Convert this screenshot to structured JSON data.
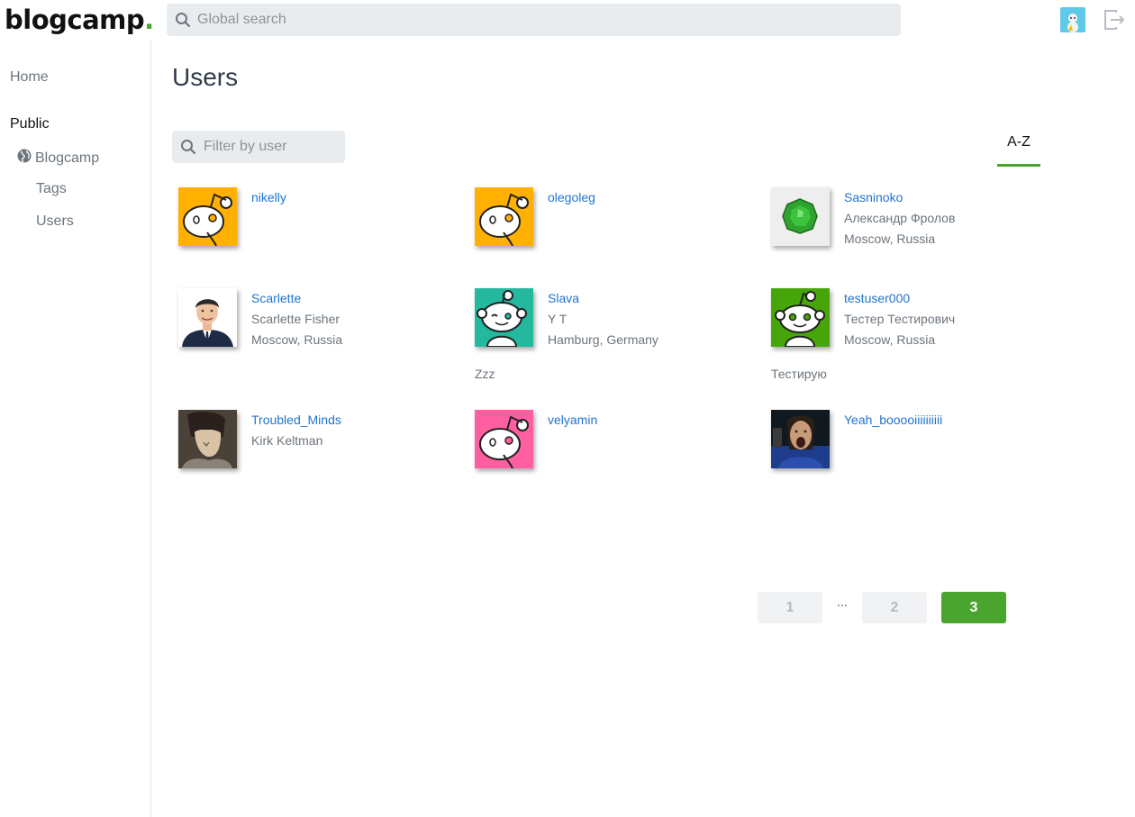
{
  "header": {
    "logo_text": "blogcamp",
    "logo_dot": ".",
    "search_placeholder": "Global search"
  },
  "sidebar": {
    "home": "Home",
    "public": "Public",
    "blogcamp": "Blogcamp",
    "tags": "Tags",
    "users": "Users"
  },
  "main": {
    "title": "Users",
    "filter_placeholder": "Filter by user",
    "sort_tab": "A-Z"
  },
  "users": [
    {
      "username": "nikelly",
      "name": "",
      "location": "",
      "about": "",
      "avatar": "reddit-snoo-thinking",
      "avatar_bg": "#ffb000"
    },
    {
      "username": "olegoleg",
      "name": "",
      "location": "",
      "about": "",
      "avatar": "reddit-snoo-thinking",
      "avatar_bg": "#ffb000"
    },
    {
      "username": "Sasninoko",
      "name": "Александр Фролов",
      "location": "Moscow, Russia",
      "about": "",
      "avatar": "green-gem",
      "avatar_bg": "#eeeeee"
    },
    {
      "username": "Scarlette",
      "name": "Scarlette Fisher",
      "location": "Moscow, Russia",
      "about": "",
      "avatar": "man-in-suit",
      "avatar_bg": "#ffffff"
    },
    {
      "username": "Slava",
      "name": "Y T",
      "location": "Hamburg, Germany",
      "about": "Zzz",
      "avatar": "reddit-snoo-winking",
      "avatar_bg": "#24b89f"
    },
    {
      "username": "testuser000",
      "name": "Тестер Тестирович",
      "location": "Moscow, Russia",
      "about": "Тестирую",
      "avatar": "reddit-snoo-smiling",
      "avatar_bg": "#46a508"
    },
    {
      "username": "Troubled_Minds",
      "name": "Kirk Keltman",
      "location": "",
      "about": "",
      "avatar": "anime-character",
      "avatar_bg": "#3a332c"
    },
    {
      "username": "velyamin",
      "name": "",
      "location": "",
      "about": "",
      "avatar": "reddit-snoo-thinking",
      "avatar_bg": "#ff5ea0"
    },
    {
      "username": "Yeah_booooiiiiiiiiii",
      "name": "",
      "location": "",
      "about": "",
      "avatar": "photo-shouting-man",
      "avatar_bg": "#1b2a55"
    }
  ],
  "pagination": {
    "pages": [
      "1",
      "2",
      "3"
    ],
    "ellipsis": "...",
    "current": "3",
    "active_color": "#4aa52e"
  },
  "colors": {
    "accent": "#4aa52e",
    "link": "#1f74d1"
  }
}
